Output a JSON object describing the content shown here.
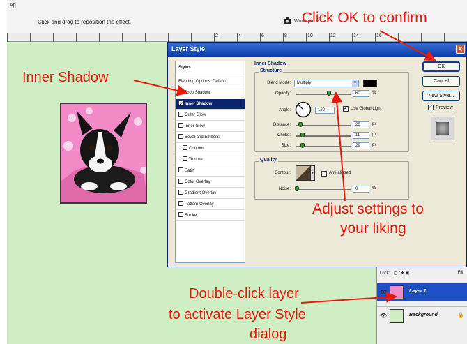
{
  "photoshop": {
    "app_label": "Ap",
    "hint": "Click and drag to reposition the effect.",
    "workspace_label": "Workspace",
    "ruler_numbers": [
      "2",
      "4",
      "6",
      "8",
      "10",
      "12",
      "14",
      "16"
    ]
  },
  "dialog": {
    "title": "Layer Style",
    "close_glyph": "✕",
    "styles_list": [
      {
        "label": "Styles",
        "kind": "header"
      },
      {
        "label": "Blending Options: Default",
        "kind": "plain"
      },
      {
        "label": "Drop Shadow",
        "kind": "check",
        "checked": false
      },
      {
        "label": "Inner Shadow",
        "kind": "check",
        "checked": true,
        "selected": true
      },
      {
        "label": "Outer Glow",
        "kind": "check",
        "checked": false
      },
      {
        "label": "Inner Glow",
        "kind": "check",
        "checked": false
      },
      {
        "label": "Bevel and Emboss",
        "kind": "check",
        "checked": false
      },
      {
        "label": "Contour",
        "kind": "check",
        "checked": false,
        "indent": true
      },
      {
        "label": "Texture",
        "kind": "check",
        "checked": false,
        "indent": true
      },
      {
        "label": "Satin",
        "kind": "check",
        "checked": false
      },
      {
        "label": "Color Overlay",
        "kind": "check",
        "checked": false
      },
      {
        "label": "Gradient Overlay",
        "kind": "check",
        "checked": false
      },
      {
        "label": "Pattern Overlay",
        "kind": "check",
        "checked": false
      },
      {
        "label": "Stroke",
        "kind": "check",
        "checked": false
      }
    ],
    "section_title": "Inner Shadow",
    "structure": {
      "title": "Structure",
      "blend_mode_label": "Blend Mode:",
      "blend_mode_value": "Multiply",
      "shadow_color": "#000000",
      "opacity_label": "Opacity:",
      "opacity_value": "60",
      "opacity_unit": "%",
      "angle_label": "Angle:",
      "angle_value": "120",
      "angle_unit": "°",
      "global_light_label": "Use Global Light",
      "distance_label": "Distance:",
      "distance_value": "20",
      "choke_label": "Choke:",
      "choke_value": "11",
      "size_label": "Size:",
      "size_value": "29",
      "px_unit": "px",
      "slider_levels": {
        "opacity": 0.6,
        "distance": 0.08,
        "choke": 0.11,
        "size": 0.12
      }
    },
    "quality": {
      "title": "Quality",
      "contour_label": "Contour:",
      "anti_aliased_label": "Anti-aliased",
      "noise_label": "Noise:",
      "noise_value": "0",
      "noise_unit": "%"
    },
    "buttons": {
      "ok": "OK",
      "cancel": "Cancel",
      "new_style": "New Style...",
      "preview": "Preview"
    }
  },
  "layers": {
    "toolbar": "Lock:",
    "fill_label": "Fill:",
    "rows": [
      {
        "name": "Layer 1",
        "selected": true
      },
      {
        "name": "Background",
        "selected": false
      }
    ]
  },
  "annotations": {
    "click_ok": "Click OK to confirm",
    "inner_shadow": "Inner Shadow",
    "adjust_line1": "Adjust settings to",
    "adjust_line2": "your liking",
    "dblclick_line1": "Double-click layer",
    "dblclick_line2": "to activate Layer Style",
    "dblclick_line3": "dialog",
    "color": "#e8190c"
  }
}
